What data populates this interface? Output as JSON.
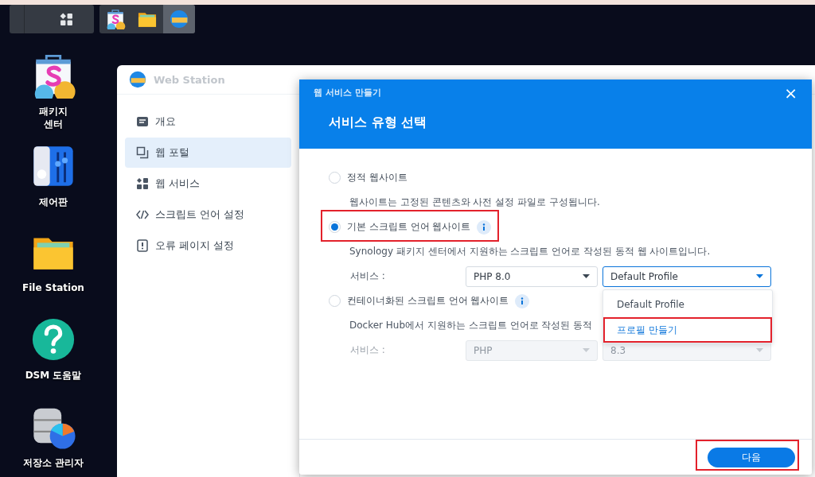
{
  "taskbar": {
    "apps": [
      {
        "kind": "package",
        "selected": false
      },
      {
        "kind": "folder",
        "selected": false
      },
      {
        "kind": "web",
        "selected": true
      }
    ]
  },
  "desktop_icons": [
    {
      "kind": "package",
      "label": "패키지\n센터"
    },
    {
      "kind": "control",
      "label": "제어판"
    },
    {
      "kind": "folder",
      "label": "File Station"
    },
    {
      "kind": "help",
      "label": "DSM 도움말"
    },
    {
      "kind": "storage",
      "label": "저장소 관리자"
    }
  ],
  "web_station": {
    "title": "Web Station",
    "sidebar": [
      {
        "kind": "overview",
        "label": "개요",
        "selected": false
      },
      {
        "kind": "portal",
        "label": "웹 포털",
        "selected": true
      },
      {
        "kind": "services",
        "label": "웹 서비스",
        "selected": false
      },
      {
        "kind": "script",
        "label": "스크립트 언어 설정",
        "selected": false
      },
      {
        "kind": "error",
        "label": "오류 페이지 설정",
        "selected": false
      }
    ]
  },
  "dialog": {
    "title": "웹 서비스 만들기",
    "close": "×",
    "heading": "서비스 유형 선택",
    "options": [
      {
        "label": "정적 웹사이트",
        "info": false,
        "selected": false,
        "description": "웹사이트는 고정된 콘텐츠와 사전 설정 파일로 구성됩니다."
      },
      {
        "label": "기본 스크립트 언어 웹사이트",
        "info": true,
        "selected": true,
        "description": "Synology 패키지 센터에서 지원하는 스크립트 언어로 작성된 동적 웹 사이트입니다.",
        "service": {
          "label": "서비스 :",
          "disabled": false,
          "selects": [
            {
              "value": "PHP 8.0",
              "open": false
            },
            {
              "value": "Default Profile",
              "open": true
            }
          ]
        }
      },
      {
        "label": "컨테이너화된 스크립트 언어 웹사이트",
        "info": true,
        "selected": false,
        "description": "Docker Hub에서 지원하는 스크립트 언어로 작성된 동적",
        "service": {
          "label": "서비스 :",
          "disabled": true,
          "selects": [
            {
              "value": "PHP",
              "open": false
            },
            {
              "value": "8.3",
              "open": false
            }
          ]
        }
      }
    ],
    "menu": [
      {
        "label": "Default Profile",
        "highlighted": false,
        "outlined": false
      },
      {
        "label": "프로필 만들기",
        "highlighted": true,
        "outlined": true
      }
    ],
    "next_button": "다음"
  }
}
